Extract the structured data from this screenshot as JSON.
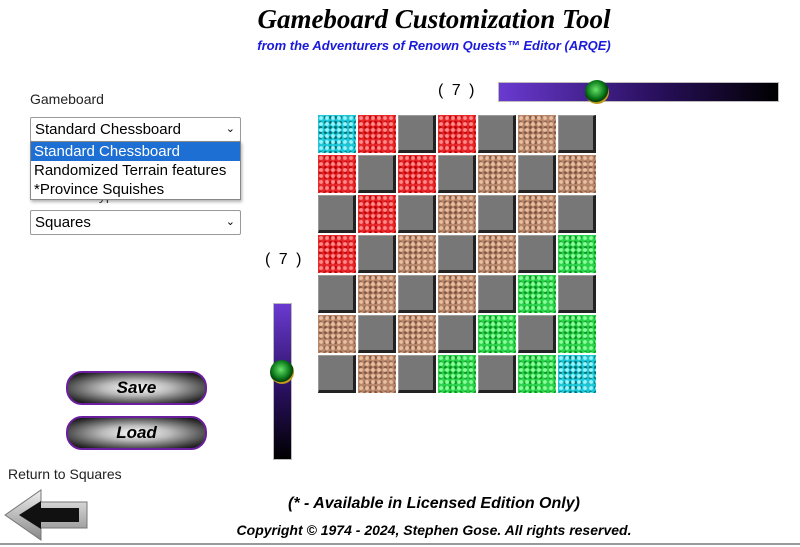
{
  "header": {
    "title": "Gameboard Customization Tool",
    "subtitle": "from the Adventurers of Renown Quests™ Editor (ARQE)"
  },
  "gameboard": {
    "label": "Gameboard",
    "selected": "Standard Chessboard",
    "options": [
      "Standard Chessboard",
      "Randomized Terrain features",
      "*Province Squishes"
    ],
    "highlighted_index": 0,
    "dropdown_open": true
  },
  "cell_type": {
    "label": "Grid Cell Type:",
    "selected": "Squares"
  },
  "columns_slider": {
    "label": "( 7 )",
    "value": 7
  },
  "rows_slider": {
    "label": "( 7 )",
    "value": 7
  },
  "buttons": {
    "save": "Save",
    "load": "Load"
  },
  "return": {
    "label": "Return to Squares",
    "icon": "back-arrow-icon"
  },
  "footer": {
    "note": "(* - Available in Licensed Edition Only)",
    "copyright": "Copyright © 1974 - 2024, Stephen Gose. All rights reserved."
  },
  "colors": {
    "subtitle": "#1a1adc",
    "button_border": "#6a1fa0",
    "highlight": "#1e6fd4"
  },
  "board": {
    "rows": [
      [
        "cyan",
        "red",
        "gray",
        "red",
        "gray",
        "brown",
        "gray"
      ],
      [
        "red",
        "gray",
        "red",
        "gray",
        "brown",
        "gray",
        "brown"
      ],
      [
        "gray",
        "red",
        "gray",
        "brown",
        "gray",
        "brown",
        "gray"
      ],
      [
        "red",
        "gray",
        "brown",
        "gray",
        "brown",
        "gray",
        "green"
      ],
      [
        "gray",
        "brown",
        "gray",
        "brown",
        "gray",
        "green",
        "gray"
      ],
      [
        "brown",
        "gray",
        "brown",
        "gray",
        "green",
        "gray",
        "green"
      ],
      [
        "gray",
        "brown",
        "gray",
        "green",
        "gray",
        "green",
        "cyan"
      ]
    ]
  }
}
